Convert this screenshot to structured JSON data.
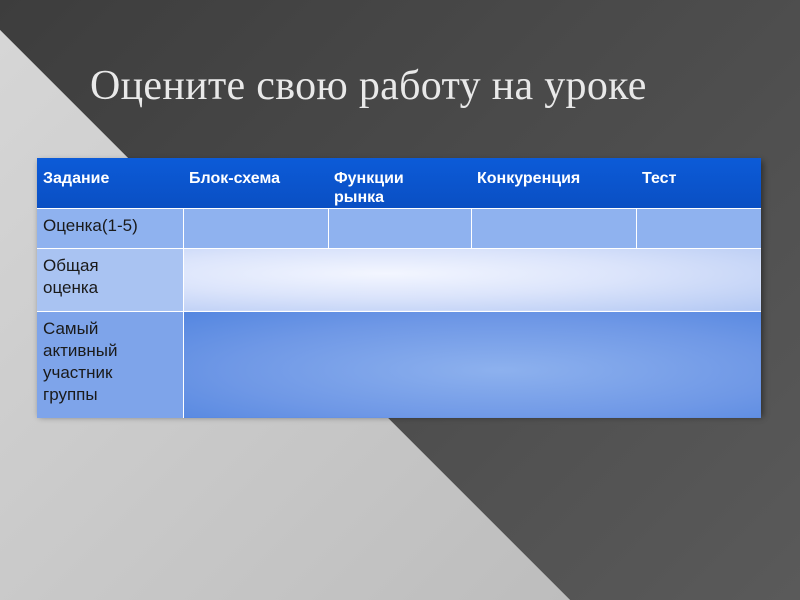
{
  "slide": {
    "title": "Оцените свою работу на уроке"
  },
  "table": {
    "headers": [
      "Задание",
      "Блок-схема",
      [
        "Функции",
        "рынка"
      ],
      "Конкуренция",
      "Тест"
    ],
    "rows": [
      {
        "label": [
          "Оценка(1-5)"
        ],
        "cells": [
          "",
          "",
          "",
          ""
        ]
      },
      {
        "label": [
          "Общая",
          "оценка"
        ]
      },
      {
        "label": [
          "Самый",
          "активный",
          "участник",
          "группы"
        ]
      }
    ]
  },
  "colors": {
    "header_blue": "#0a4fc3",
    "background_dark": "#444444",
    "background_light": "#c8c8c8"
  }
}
